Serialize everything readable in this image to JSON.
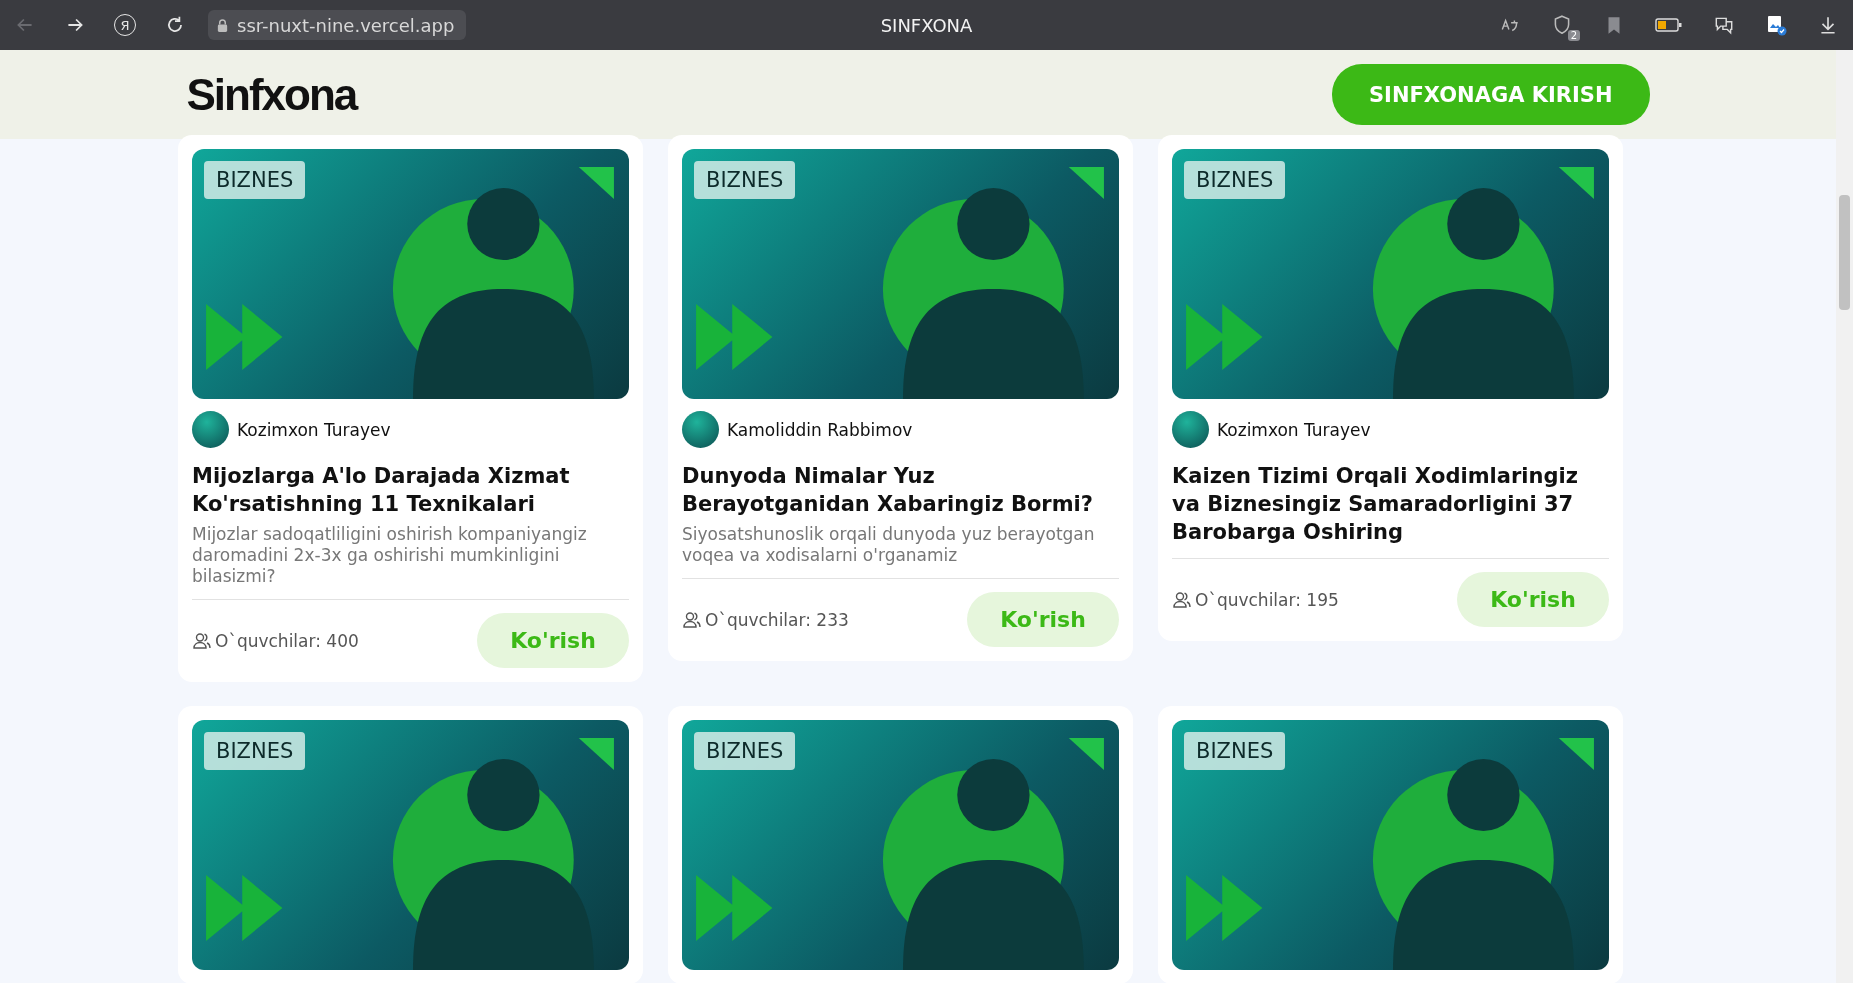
{
  "browser": {
    "logo_glyph": "Я",
    "url": "ssr-nuxt-nine.vercel.app",
    "title": "SINFXONA",
    "shield_badge": "2"
  },
  "header": {
    "logo": "Sinfxona",
    "login_button": "SINFXONAGA KIRISH"
  },
  "courses": [
    {
      "tag": "BIZNES",
      "author": "Kozimxon Turayev",
      "title": "Mijozlarga A'lo Darajada Xizmat Ko'rsatishning 11 Texnikalari",
      "description": "Mijozlar sadoqatliligini oshirish kompaniyangiz daromadini 2x-3x ga oshirishi mumkinligini bilasizmi?",
      "readers": "O`quvchilar: 400",
      "button": "Ko'rish"
    },
    {
      "tag": "BIZNES",
      "author": "Kamoliddin Rabbimov",
      "title": "Dunyoda Nimalar Yuz Berayotganidan Xabaringiz Bormi?",
      "description": "Siyosatshunoslik orqali dunyoda yuz berayotgan voqea va xodisalarni o'rganamiz",
      "readers": "O`quvchilar: 233",
      "button": "Ko'rish"
    },
    {
      "tag": "BIZNES",
      "author": "Kozimxon Turayev",
      "title": "Kaizen Tizimi Orqali Xodimlaringiz va Biznesingiz Samaradorligini 37 Barobarga Oshiring",
      "readers": "O`quvchilar: 195",
      "button": "Ko'rish"
    },
    {
      "tag": "BIZNES"
    },
    {
      "tag": "BIZNES"
    },
    {
      "tag": "BIZNES"
    }
  ]
}
